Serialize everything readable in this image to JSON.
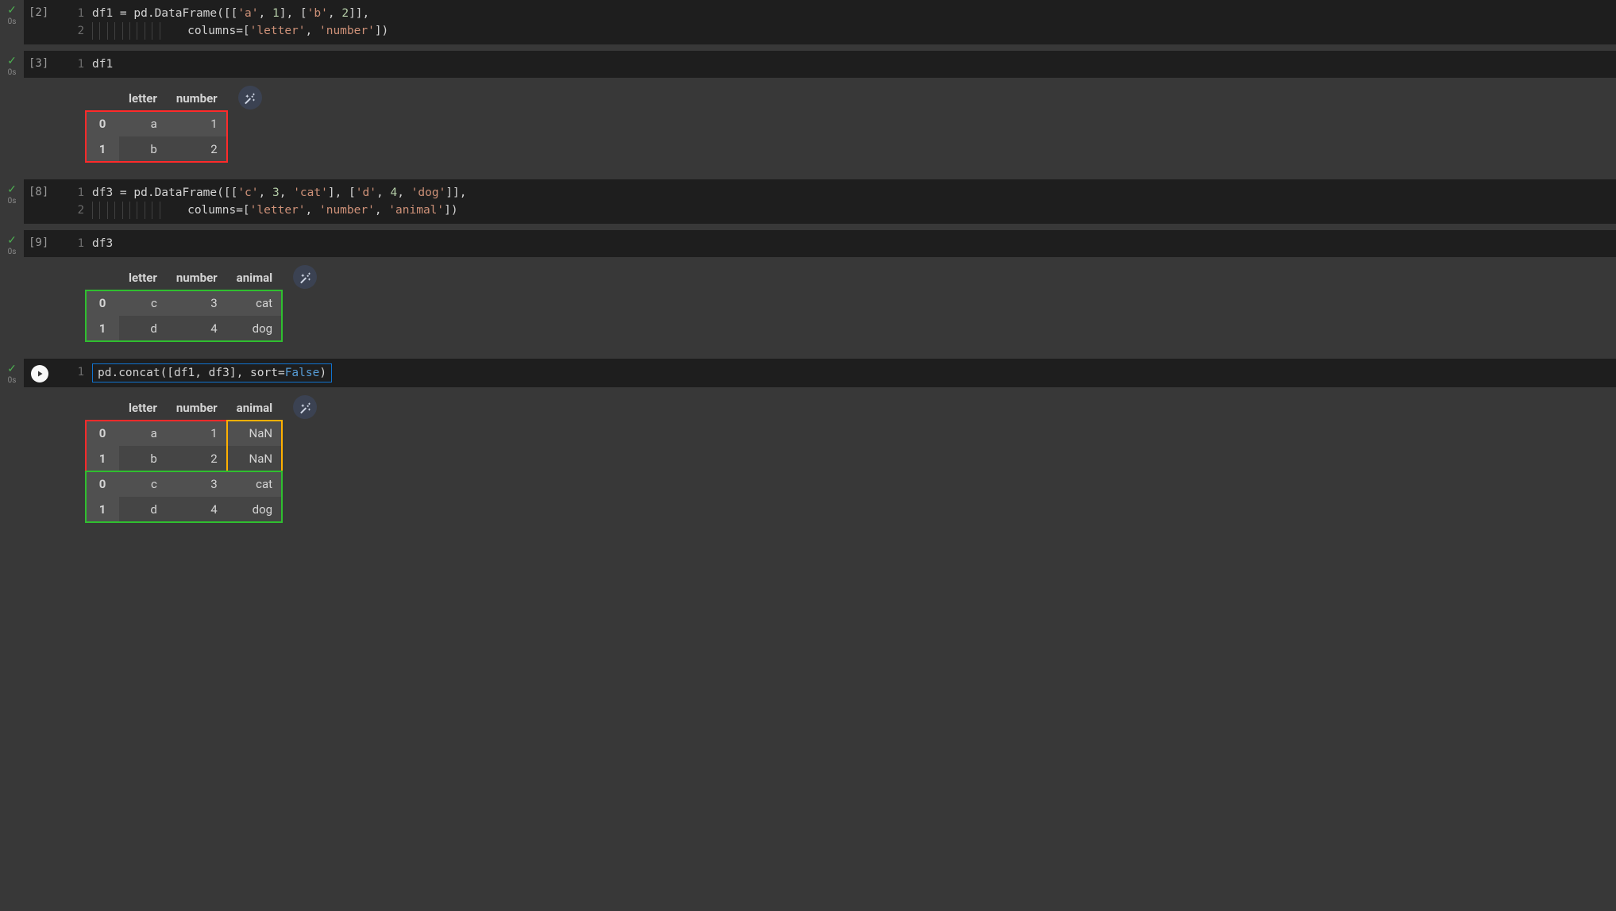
{
  "cells": [
    {
      "id": "c2",
      "exec_count": "[2]",
      "timing": "0s",
      "status": "ok",
      "lines": [
        "1",
        "2"
      ],
      "code_html": "df1 = pd.DataFrame([[<span class='tok-str'>'a'</span>, <span class='tok-num'>1</span>], [<span class='tok-str'>'b'</span>, <span class='tok-num'>2</span>]],\n<span class='indent-guide'></span><span class='indent-guide'></span><span class='indent-guide'></span><span class='indent-guide'></span><span class='indent-guide'></span><span class='indent-guide'></span><span class='indent-guide'></span><span class='indent-guide'></span><span class='indent-guide'></span><span class='indent-guide'></span>   columns=[<span class='tok-str'>'letter'</span>, <span class='tok-str'>'number'</span>])"
    },
    {
      "id": "c3",
      "exec_count": "[3]",
      "timing": "0s",
      "status": "ok",
      "lines": [
        "1"
      ],
      "code_html": "df1",
      "output_table": {
        "columns": [
          "letter",
          "number"
        ],
        "rows": [
          {
            "idx": "0",
            "vals": [
              "a",
              "1"
            ]
          },
          {
            "idx": "1",
            "vals": [
              "b",
              "2"
            ]
          }
        ],
        "overlays": [
          {
            "class": "ov-red",
            "rowStart": 0,
            "rowEnd": 2,
            "colStart": 0,
            "colEnd": 3
          }
        ]
      }
    },
    {
      "id": "c8",
      "exec_count": "[8]",
      "timing": "0s",
      "status": "ok",
      "lines": [
        "1",
        "2"
      ],
      "code_html": "df3 = pd.DataFrame([[<span class='tok-str'>'c'</span>, <span class='tok-num'>3</span>, <span class='tok-str'>'cat'</span>], [<span class='tok-str'>'d'</span>, <span class='tok-num'>4</span>, <span class='tok-str'>'dog'</span>]],\n<span class='indent-guide'></span><span class='indent-guide'></span><span class='indent-guide'></span><span class='indent-guide'></span><span class='indent-guide'></span><span class='indent-guide'></span><span class='indent-guide'></span><span class='indent-guide'></span><span class='indent-guide'></span><span class='indent-guide'></span>   columns=[<span class='tok-str'>'letter'</span>, <span class='tok-str'>'number'</span>, <span class='tok-str'>'animal'</span>])"
    },
    {
      "id": "c9",
      "exec_count": "[9]",
      "timing": "0s",
      "status": "ok",
      "lines": [
        "1"
      ],
      "code_html": "df3",
      "output_table": {
        "columns": [
          "letter",
          "number",
          "animal"
        ],
        "rows": [
          {
            "idx": "0",
            "vals": [
              "c",
              "3",
              "cat"
            ]
          },
          {
            "idx": "1",
            "vals": [
              "d",
              "4",
              "dog"
            ]
          }
        ],
        "overlays": [
          {
            "class": "ov-green",
            "rowStart": 0,
            "rowEnd": 2,
            "colStart": 0,
            "colEnd": 4
          }
        ]
      }
    },
    {
      "id": "cLast",
      "exec_count_is_run": true,
      "timing": "0s",
      "status": "ok",
      "lines": [
        "1"
      ],
      "code_boxed": true,
      "code_html": "pd.concat([df1, df3], sort=<span class='tok-kw'>False</span>)",
      "output_table": {
        "columns": [
          "letter",
          "number",
          "animal"
        ],
        "rows": [
          {
            "idx": "0",
            "vals": [
              "a",
              "1",
              "NaN"
            ]
          },
          {
            "idx": "1",
            "vals": [
              "b",
              "2",
              "NaN"
            ]
          },
          {
            "idx": "0",
            "vals": [
              "c",
              "3",
              "cat"
            ]
          },
          {
            "idx": "1",
            "vals": [
              "d",
              "4",
              "dog"
            ]
          }
        ],
        "overlays": [
          {
            "class": "ov-red",
            "rowStart": 0,
            "rowEnd": 2,
            "colStart": 0,
            "colEnd": 3
          },
          {
            "class": "ov-orange",
            "rowStart": 0,
            "rowEnd": 2,
            "colStart": 3,
            "colEnd": 4
          },
          {
            "class": "ov-green",
            "rowStart": 2,
            "rowEnd": 4,
            "colStart": 0,
            "colEnd": 4
          }
        ]
      }
    }
  ],
  "icons": {
    "check": "✓",
    "wand_title": "Suggest charts"
  }
}
